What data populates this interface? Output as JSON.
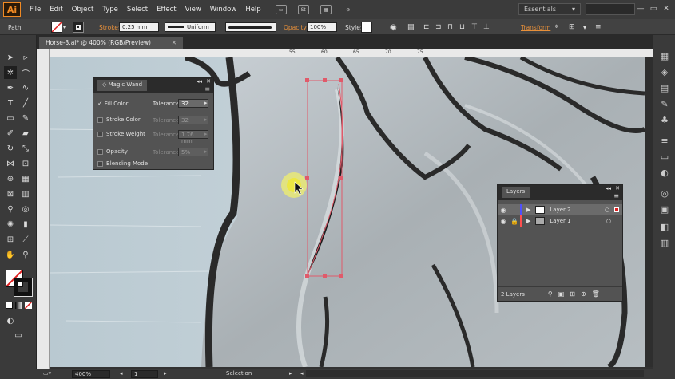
{
  "app": {
    "logo": "Ai",
    "accent": "#f08a24"
  },
  "menu": [
    "File",
    "Edit",
    "Object",
    "Type",
    "Select",
    "Effect",
    "View",
    "Window",
    "Help"
  ],
  "menubar_icons": [
    "bridge-icon",
    "stock-icon",
    "arrange-icon",
    "gpu-icon"
  ],
  "menubar_icon_text": {
    "stock": "St"
  },
  "workspace": "Essentials",
  "window_controls": [
    "minimize-icon",
    "maximize-icon",
    "close-icon"
  ],
  "control": {
    "selection_type": "Path",
    "stroke_label": "Stroke:",
    "stroke_value": "0.25 mm",
    "profile": "Uniform",
    "opacity_label": "Opacity:",
    "opacity_value": "100%",
    "style_label": "Style:",
    "transform": "Transform"
  },
  "document_tab": "Horse-3.ai* @ 400% (RGB/Preview)",
  "ruler_ticks": [
    "55",
    "60",
    "65",
    "70",
    "75"
  ],
  "magic_wand": {
    "title": "Magic Wand",
    "rows": [
      {
        "label": "Fill Color",
        "checked": true,
        "tolerance_label": "Tolerance:",
        "tolerance": "32",
        "enabled": true
      },
      {
        "label": "Stroke Color",
        "checked": false,
        "tolerance_label": "Tolerance:",
        "tolerance": "32",
        "enabled": false
      },
      {
        "label": "Stroke Weight",
        "checked": false,
        "tolerance_label": "Tolerance:",
        "tolerance": "1.76 mm",
        "enabled": false
      },
      {
        "label": "Opacity",
        "checked": false,
        "tolerance_label": "Tolerance:",
        "tolerance": "5%",
        "enabled": false
      },
      {
        "label": "Blending Mode",
        "checked": false
      }
    ]
  },
  "layers": {
    "title": "Layers",
    "rows": [
      {
        "name": "Layer 2",
        "color": "#4f4fff",
        "selected": true
      },
      {
        "name": "Layer 1",
        "color": "#ff4f4f",
        "selected": false
      }
    ],
    "footer": "2 Layers"
  },
  "status": {
    "zoom": "400%",
    "artboard": "1",
    "tool": "Selection"
  }
}
